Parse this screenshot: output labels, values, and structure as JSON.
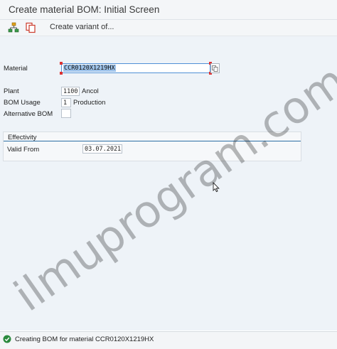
{
  "header": {
    "title": "Create material BOM: Initial Screen",
    "create_variant_label": "Create variant of..."
  },
  "form": {
    "material": {
      "label": "Material",
      "value": "CCR0120X1219HX"
    },
    "plant": {
      "label": "Plant",
      "value": "1100",
      "description": "Ancol"
    },
    "bom_usage": {
      "label": "BOM Usage",
      "value": "1",
      "description": "Production"
    },
    "alternative_bom": {
      "label": "Alternative BOM",
      "value": ""
    }
  },
  "effectivity": {
    "title": "Effectivity",
    "valid_from": {
      "label": "Valid From",
      "value": "03.07.2021"
    }
  },
  "status": {
    "type": "success",
    "message": "Creating BOM for material CCR0120X1219HX",
    "color": "#2b8a3e"
  },
  "watermark": {
    "text": "ilmuprogram.com"
  },
  "colors": {
    "accent": "#2e6fa5",
    "selection": "#9fc3ea",
    "required_marker": "#dd3333"
  },
  "icons": [
    "hierarchy-icon",
    "copy-icon",
    "value-help-icon",
    "success-icon",
    "mouse-cursor-icon"
  ]
}
